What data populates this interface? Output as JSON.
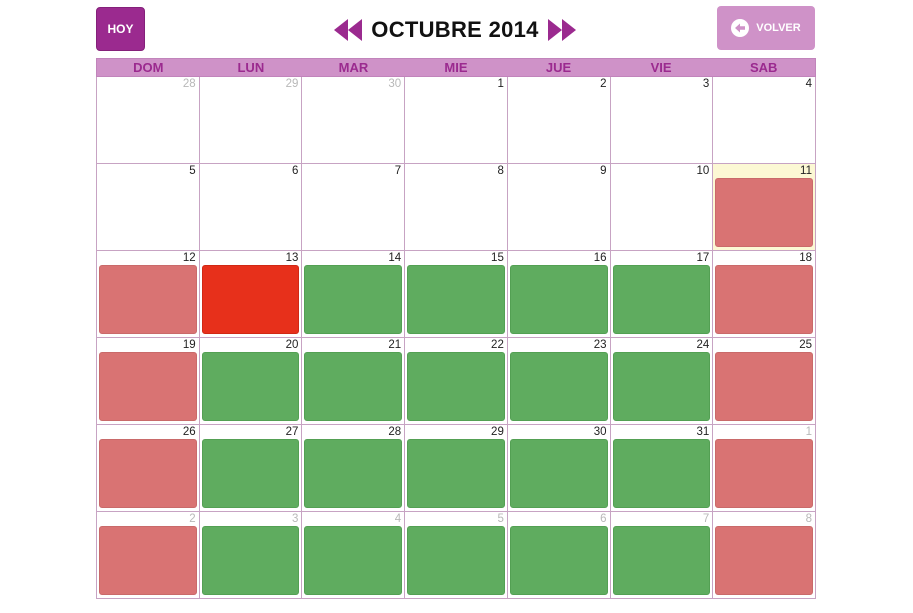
{
  "toolbar": {
    "today_label": "HOY",
    "month_title": "OCTUBRE 2014",
    "back_label": "VOLVER"
  },
  "weekdays": [
    "DOM",
    "LUN",
    "MAR",
    "MIE",
    "JUE",
    "VIE",
    "SAB"
  ],
  "colors": {
    "primary": "#9b2a8f",
    "header_bg": "#cf92c8",
    "available": "#5fac5f",
    "weekend": "#d97373",
    "selected": "#e7301b",
    "today_bg": "#fcf8d4"
  },
  "weeks": [
    [
      {
        "day": "28",
        "other": true
      },
      {
        "day": "29",
        "other": true
      },
      {
        "day": "30",
        "other": true
      },
      {
        "day": "1"
      },
      {
        "day": "2"
      },
      {
        "day": "3"
      },
      {
        "day": "4"
      }
    ],
    [
      {
        "day": "5"
      },
      {
        "day": "6"
      },
      {
        "day": "7"
      },
      {
        "day": "8"
      },
      {
        "day": "9"
      },
      {
        "day": "10"
      },
      {
        "day": "11",
        "today": true,
        "event": "pink"
      }
    ],
    [
      {
        "day": "12",
        "event": "pink"
      },
      {
        "day": "13",
        "event": "red"
      },
      {
        "day": "14",
        "event": "green"
      },
      {
        "day": "15",
        "event": "green"
      },
      {
        "day": "16",
        "event": "green"
      },
      {
        "day": "17",
        "event": "green"
      },
      {
        "day": "18",
        "event": "pink"
      }
    ],
    [
      {
        "day": "19",
        "event": "pink"
      },
      {
        "day": "20",
        "event": "green"
      },
      {
        "day": "21",
        "event": "green"
      },
      {
        "day": "22",
        "event": "green"
      },
      {
        "day": "23",
        "event": "green"
      },
      {
        "day": "24",
        "event": "green"
      },
      {
        "day": "25",
        "event": "pink"
      }
    ],
    [
      {
        "day": "26",
        "event": "pink"
      },
      {
        "day": "27",
        "event": "green"
      },
      {
        "day": "28",
        "event": "green"
      },
      {
        "day": "29",
        "event": "green"
      },
      {
        "day": "30",
        "event": "green"
      },
      {
        "day": "31",
        "event": "green"
      },
      {
        "day": "1",
        "other": true,
        "event": "pink"
      }
    ],
    [
      {
        "day": "2",
        "other": true,
        "event": "pink"
      },
      {
        "day": "3",
        "other": true,
        "event": "green"
      },
      {
        "day": "4",
        "other": true,
        "event": "green"
      },
      {
        "day": "5",
        "other": true,
        "event": "green"
      },
      {
        "day": "6",
        "other": true,
        "event": "green"
      },
      {
        "day": "7",
        "other": true,
        "event": "green"
      },
      {
        "day": "8",
        "other": true,
        "event": "pink"
      }
    ]
  ]
}
